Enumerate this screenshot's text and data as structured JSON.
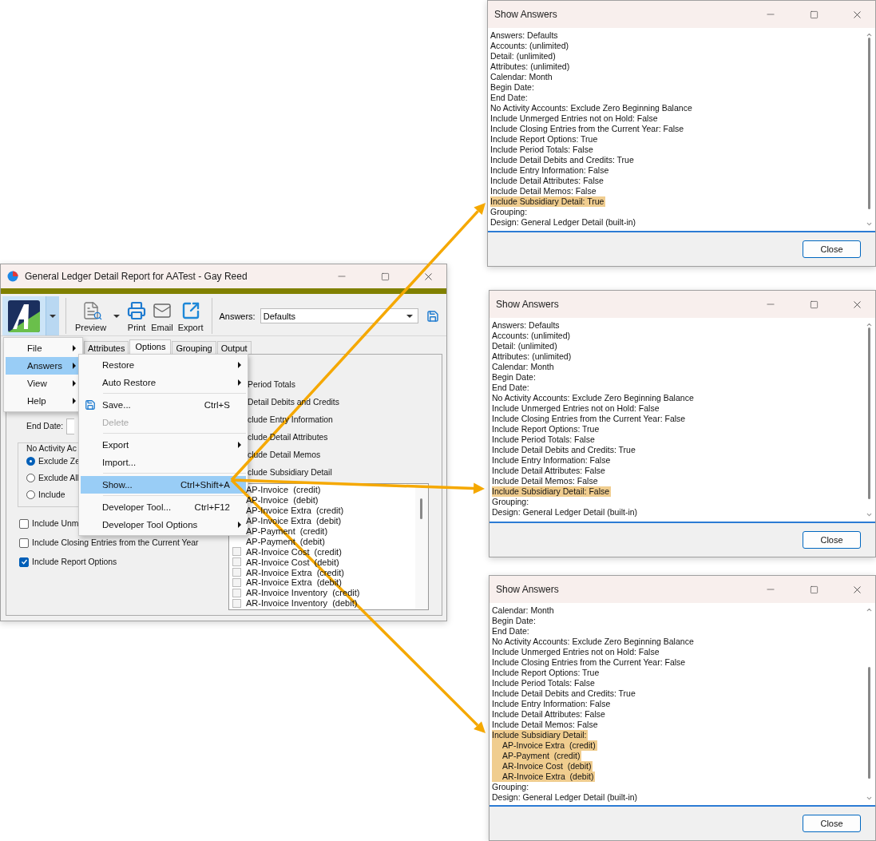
{
  "main_window": {
    "title": "General Ledger Detail Report for AATest - Gay Reed",
    "toolbar": {
      "buttons": [
        {
          "label": "Preview",
          "kind": "preview"
        },
        {
          "label": "Print",
          "kind": "print"
        },
        {
          "label": "Email",
          "kind": "email"
        },
        {
          "label": "Export",
          "kind": "export"
        }
      ],
      "answers_label": "Answers:",
      "answers_value": "Defaults"
    },
    "tabs": [
      {
        "label": "Attributes",
        "selected": false
      },
      {
        "label": "Options",
        "selected": true
      },
      {
        "label": "Grouping",
        "selected": false
      },
      {
        "label": "Output",
        "selected": false
      }
    ],
    "end_date_label": "End Date:",
    "group_label": "No Activity Ac",
    "radios": [
      {
        "label": "Exclude Ze",
        "selected": true
      },
      {
        "label": "Exclude All",
        "selected": false
      },
      {
        "label": "Include",
        "selected": false
      }
    ],
    "checkboxes": [
      {
        "label": "Include Unm",
        "checked": false
      },
      {
        "label": "Include Closing Entries from the Current Year",
        "checked": false
      },
      {
        "label": "Include Report Options",
        "checked": true
      }
    ],
    "right_options": [
      "Period Totals",
      "Detail Debits and Credits",
      "clude Entry Information",
      "clude Detail Attributes",
      "clude Detail Memos",
      "clude Subsidiary Detail"
    ],
    "subsidiary_items": [
      {
        "label": "AP-Invoice  (credit)"
      },
      {
        "label": "AP-Invoice  (debit)"
      },
      {
        "label": "AP-Invoice Extra  (credit)"
      },
      {
        "label": "AP-Invoice Extra  (debit)"
      },
      {
        "label": "AP-Payment  (credit)"
      },
      {
        "label": "AP-Payment  (debit)"
      },
      {
        "label": "AR-Invoice Cost  (credit)",
        "checked": false
      },
      {
        "label": "AR-Invoice Cost  (debit)",
        "checked": false
      },
      {
        "label": "AR-Invoice Extra  (credit)",
        "checked": false
      },
      {
        "label": "AR-Invoice Extra  (debit)",
        "checked": false
      },
      {
        "label": "AR-Invoice Inventory  (credit)",
        "checked": false
      },
      {
        "label": "AR-Invoice Inventory  (debit)",
        "checked": false
      }
    ]
  },
  "menu": {
    "items": [
      {
        "label": "File",
        "selected": false
      },
      {
        "label": "Answers",
        "selected": true
      },
      {
        "label": "View",
        "selected": false
      },
      {
        "label": "Help",
        "selected": false
      }
    ]
  },
  "submenu": {
    "items": [
      {
        "kind": "item",
        "label": "Restore",
        "has_submenu": true,
        "selected": false,
        "disabled": false
      },
      {
        "kind": "item",
        "label": "Auto Restore",
        "has_submenu": true,
        "selected": false,
        "disabled": false
      },
      {
        "kind": "separator"
      },
      {
        "kind": "item",
        "label": "Save...",
        "shortcut": "Ctrl+S",
        "has_icon": true,
        "selected": false,
        "disabled": false
      },
      {
        "kind": "item",
        "label": "Delete",
        "selected": false,
        "disabled": true
      },
      {
        "kind": "separator"
      },
      {
        "kind": "item",
        "label": "Export",
        "has_submenu": true,
        "selected": false,
        "disabled": false
      },
      {
        "kind": "item",
        "label": "Import...",
        "selected": false,
        "disabled": false
      },
      {
        "kind": "separator"
      },
      {
        "kind": "item",
        "label": "Show...",
        "shortcut": "Ctrl+Shift+A",
        "selected": true,
        "disabled": false
      },
      {
        "kind": "separator"
      },
      {
        "kind": "item",
        "label": "Developer Tool...",
        "shortcut": "Ctrl+F12",
        "selected": false,
        "disabled": false
      },
      {
        "kind": "item",
        "label": "Developer Tool Options",
        "has_submenu": true,
        "selected": false,
        "disabled": false
      }
    ]
  },
  "dialogs": [
    {
      "title": "Show Answers",
      "lines": [
        {
          "text": "Answers: Defaults",
          "highlighted": false
        },
        {
          "text": "Accounts: (unlimited)",
          "highlighted": false
        },
        {
          "text": "Detail: (unlimited)",
          "highlighted": false
        },
        {
          "text": "Attributes: (unlimited)",
          "highlighted": false
        },
        {
          "text": "Calendar: Month",
          "highlighted": false
        },
        {
          "text": "Begin Date:",
          "highlighted": false
        },
        {
          "text": "End Date:",
          "highlighted": false
        },
        {
          "text": "No Activity Accounts: Exclude Zero Beginning Balance",
          "highlighted": false
        },
        {
          "text": "Include Unmerged Entries not on Hold: False",
          "highlighted": false
        },
        {
          "text": "Include Closing Entries from the Current Year: False",
          "highlighted": false
        },
        {
          "text": "Include Report Options: True",
          "highlighted": false
        },
        {
          "text": "Include Period Totals: False",
          "highlighted": false
        },
        {
          "text": "Include Detail Debits and Credits: True",
          "highlighted": false
        },
        {
          "text": "Include Entry Information: False",
          "highlighted": false
        },
        {
          "text": "Include Detail Attributes: False",
          "highlighted": false
        },
        {
          "text": "Include Detail Memos: False",
          "highlighted": false
        },
        {
          "text": "Include Subsidiary Detail: True",
          "highlighted": true
        },
        {
          "text": "Grouping:",
          "highlighted": false
        },
        {
          "text": "Design: General Ledger Detail (built-in)",
          "highlighted": false
        }
      ],
      "close": "Close"
    },
    {
      "title": "Show Answers",
      "lines": [
        {
          "text": "Answers: Defaults",
          "highlighted": false
        },
        {
          "text": "Accounts: (unlimited)",
          "highlighted": false
        },
        {
          "text": "Detail: (unlimited)",
          "highlighted": false
        },
        {
          "text": "Attributes: (unlimited)",
          "highlighted": false
        },
        {
          "text": "Calendar: Month",
          "highlighted": false
        },
        {
          "text": "Begin Date:",
          "highlighted": false
        },
        {
          "text": "End Date:",
          "highlighted": false
        },
        {
          "text": "No Activity Accounts: Exclude Zero Beginning Balance",
          "highlighted": false
        },
        {
          "text": "Include Unmerged Entries not on Hold: False",
          "highlighted": false
        },
        {
          "text": "Include Closing Entries from the Current Year: False",
          "highlighted": false
        },
        {
          "text": "Include Report Options: True",
          "highlighted": false
        },
        {
          "text": "Include Period Totals: False",
          "highlighted": false
        },
        {
          "text": "Include Detail Debits and Credits: True",
          "highlighted": false
        },
        {
          "text": "Include Entry Information: False",
          "highlighted": false
        },
        {
          "text": "Include Detail Attributes: False",
          "highlighted": false
        },
        {
          "text": "Include Detail Memos: False",
          "highlighted": false
        },
        {
          "text": "Include Subsidiary Detail: False",
          "highlighted": true
        },
        {
          "text": "Grouping:",
          "highlighted": false
        },
        {
          "text": "Design: General Ledger Detail (built-in)",
          "highlighted": false
        }
      ],
      "close": "Close"
    },
    {
      "title": "Show Answers",
      "lines": [
        {
          "text": "Calendar: Month",
          "highlighted": false
        },
        {
          "text": "Begin Date:",
          "highlighted": false
        },
        {
          "text": "End Date:",
          "highlighted": false
        },
        {
          "text": "No Activity Accounts: Exclude Zero Beginning Balance",
          "highlighted": false
        },
        {
          "text": "Include Unmerged Entries not on Hold: False",
          "highlighted": false
        },
        {
          "text": "Include Closing Entries from the Current Year: False",
          "highlighted": false
        },
        {
          "text": "Include Report Options: True",
          "highlighted": false
        },
        {
          "text": "Include Period Totals: False",
          "highlighted": false
        },
        {
          "text": "Include Detail Debits and Credits: True",
          "highlighted": false
        },
        {
          "text": "Include Entry Information: False",
          "highlighted": false
        },
        {
          "text": "Include Detail Attributes: False",
          "highlighted": false
        },
        {
          "text": "Include Detail Memos: False",
          "highlighted": false
        },
        {
          "text": "Include Subsidiary Detail:",
          "highlighted": true,
          "children": [
            {
              "text": "AP-Invoice Extra  (credit)",
              "highlighted": true
            },
            {
              "text": "AP-Payment  (credit)",
              "highlighted": true
            },
            {
              "text": "AR-Invoice Cost  (debit)",
              "highlighted": true
            },
            {
              "text": "AR-Invoice Extra  (debit)",
              "highlighted": true
            }
          ]
        },
        {
          "text": "Grouping:",
          "highlighted": false
        },
        {
          "text": "Design: General Ledger Detail (built-in)",
          "highlighted": false
        }
      ],
      "close": "Close"
    }
  ]
}
